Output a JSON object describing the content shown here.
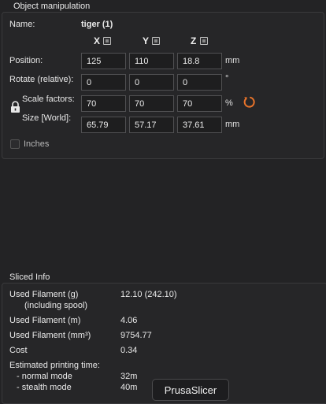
{
  "object_manipulation": {
    "title": "Object manipulation",
    "name_label": "Name:",
    "name_value": "tiger (1)",
    "axes": [
      "X",
      "Y",
      "Z"
    ],
    "position": {
      "label": "Position:",
      "x": "125",
      "y": "110",
      "z": "18.8",
      "unit": "mm"
    },
    "rotate": {
      "label": "Rotate (relative):",
      "x": "0",
      "y": "0",
      "z": "0",
      "unit": "°"
    },
    "scale": {
      "label": "Scale factors:",
      "x": "70",
      "y": "70",
      "z": "70",
      "unit": "%"
    },
    "size": {
      "label": "Size [World]:",
      "x": "65.79",
      "y": "57.17",
      "z": "37.61",
      "unit": "mm"
    },
    "inches_label": "Inches",
    "inches_checked": false
  },
  "sliced_info": {
    "title": "Sliced Info",
    "rows": [
      {
        "label": "Used Filament (g)",
        "sublabel": "(including spool)",
        "value": "12.10 (242.10)"
      },
      {
        "label": "Used Filament (m)",
        "value": "4.06"
      },
      {
        "label": "Used Filament (mm³)",
        "value": "9754.77"
      },
      {
        "label": "Cost",
        "value": "0.34"
      }
    ],
    "print_time_label": "Estimated printing time:",
    "normal_mode_label": "- normal mode",
    "normal_mode_value": "32m",
    "stealth_mode_label": "- stealth mode",
    "stealth_mode_value": "40m"
  },
  "tooltip": "PrusaSlicer",
  "colors": {
    "reset_icon": "#e8732a",
    "background": "#232325"
  }
}
